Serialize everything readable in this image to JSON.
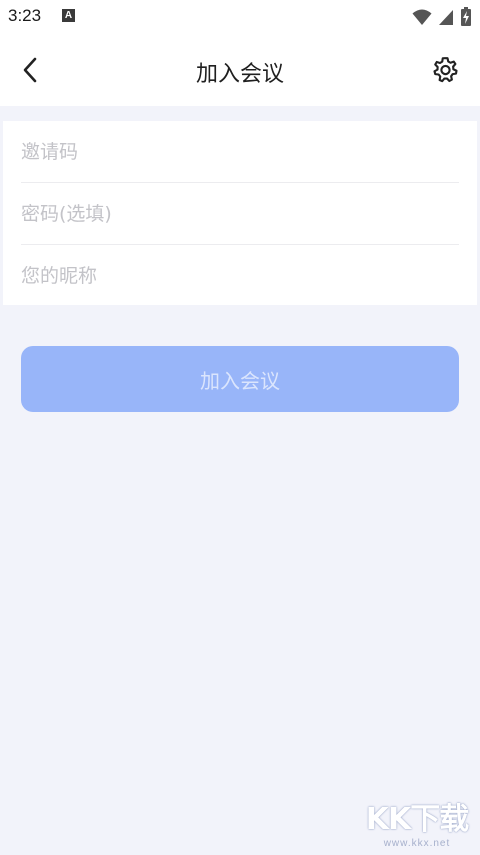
{
  "status_bar": {
    "time": "3:23",
    "notification_icon_letter": "A",
    "icons": [
      "wifi-icon",
      "signal-icon",
      "battery-charging-icon"
    ]
  },
  "header": {
    "title": "加入会议",
    "back_icon": "chevron-left-icon",
    "settings_icon": "gear-icon"
  },
  "form": {
    "invite_code_placeholder": "邀请码",
    "password_placeholder": "密码(选填)",
    "nickname_placeholder": "您的昵称"
  },
  "join_button_label": "加入会议",
  "colors": {
    "background": "#f2f3fa",
    "button": "#98b5f9",
    "button_text": "#dbe5fd",
    "placeholder": "#c3c3c8"
  },
  "watermark": {
    "logo": "KK下载",
    "url": "www.kkx.net"
  }
}
